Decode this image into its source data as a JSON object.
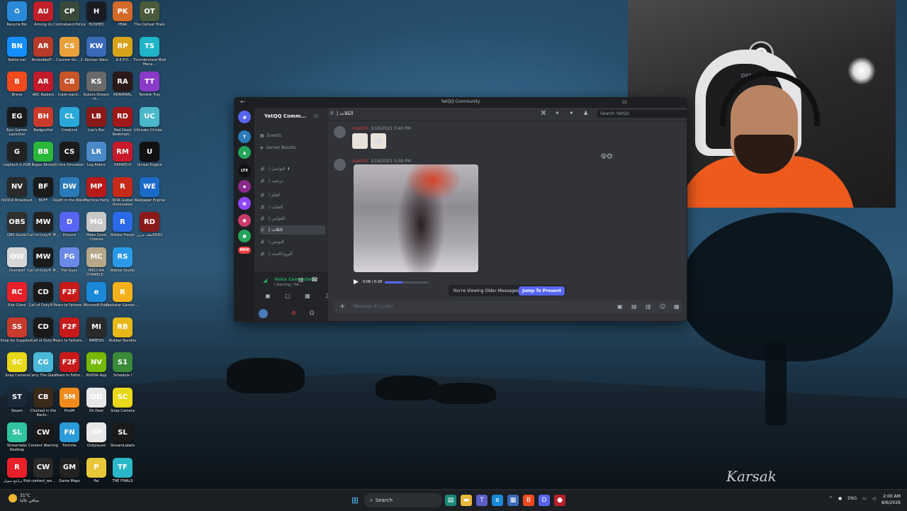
{
  "desktop": {
    "icons": [
      {
        "label": "Recycle Bin",
        "color": "#2a8ad8",
        "glyph": "♻"
      },
      {
        "label": "Among Us",
        "color": "#c0202a",
        "glyph": "AU"
      },
      {
        "label": "Contraband Police",
        "color": "#3a4a3a",
        "glyph": "CP"
      },
      {
        "label": "HUSHED",
        "color": "#1a1a22",
        "glyph": "H"
      },
      {
        "label": "PEAK",
        "color": "#d46a2a",
        "glyph": "PK"
      },
      {
        "label": "The Outlast Trials",
        "color": "#4a5a3a",
        "glyph": "OT"
      },
      {
        "label": "Battle.net",
        "color": "#148eff",
        "glyph": "BN"
      },
      {
        "label": "AnimeRedT...",
        "color": "#b83a2a",
        "glyph": "AR"
      },
      {
        "label": "Counter-Str... 2",
        "color": "#e8a13a",
        "glyph": "CS"
      },
      {
        "label": "Kitchen Wars",
        "color": "#3a6ab8",
        "glyph": "KW"
      },
      {
        "label": "R.E.P.O.",
        "color": "#d8a21a",
        "glyph": "RP"
      },
      {
        "label": "Thunderstore Mod Mana...",
        "color": "#1fb4c8",
        "glyph": "TS"
      },
      {
        "label": "Brave",
        "color": "#f04a1e",
        "glyph": "B"
      },
      {
        "label": "ARC Raiders",
        "color": "#c21a2a",
        "glyph": "AR"
      },
      {
        "label": "crash-band...",
        "color": "#c8552a",
        "glyph": "CB"
      },
      {
        "label": "Kukoro Stream ch...",
        "color": "#6a6a6a",
        "glyph": "KS"
      },
      {
        "label": "REANIMAL",
        "color": "#2a1a1a",
        "glyph": "RA"
      },
      {
        "label": "Twinkle Tray",
        "color": "#8a3ac8",
        "glyph": "TT"
      },
      {
        "label": "Epic Games Launcher",
        "color": "#1a1a1a",
        "glyph": "EG"
      },
      {
        "label": "BadgesHat",
        "color": "#c83a2a",
        "glyph": "BH"
      },
      {
        "label": "CrewLink",
        "color": "#2aa8d8",
        "glyph": "CL"
      },
      {
        "label": "Liar's Bar",
        "color": "#8a1a1a",
        "glyph": "LB"
      },
      {
        "label": "Red Dead Redempti...",
        "color": "#a01818",
        "glyph": "RD"
      },
      {
        "label": "Ultimate Chicke...",
        "color": "#4ab8c8",
        "glyph": "UC"
      },
      {
        "label": "Logitech G HUB",
        "color": "#222222",
        "glyph": "G"
      },
      {
        "label": "Bogos Binted",
        "color": "#2ab83a",
        "glyph": "BB"
      },
      {
        "label": "Crime Simulator",
        "color": "#1a1a1a",
        "glyph": "CS"
      },
      {
        "label": "Log Riders",
        "color": "#4a8ac8",
        "glyph": "LR"
      },
      {
        "label": "REMATCH",
        "color": "#c81a2a",
        "glyph": "RM"
      },
      {
        "label": "Unreal Engine",
        "color": "#111111",
        "glyph": "U"
      },
      {
        "label": "NVIDIA Broadcast",
        "color": "#2a2a2a",
        "glyph": "NV"
      },
      {
        "label": "BUFF",
        "color": "#1a1a1a",
        "glyph": "BF"
      },
      {
        "label": "Death in the Water",
        "color": "#2a7ab8",
        "glyph": "DW"
      },
      {
        "label": "Machine Party",
        "color": "#b81a1a",
        "glyph": "MP"
      },
      {
        "label": "RISK Global Domination",
        "color": "#c82a1a",
        "glyph": "R"
      },
      {
        "label": "Wallpaper Engine -...",
        "color": "#1a6ac8",
        "glyph": "WE"
      },
      {
        "label": "OBS Studio",
        "color": "#303030",
        "glyph": "OBS"
      },
      {
        "label": "Call of Duty® M...",
        "color": "#222222",
        "glyph": "MW"
      },
      {
        "label": "Discord",
        "color": "#5865f2",
        "glyph": "D"
      },
      {
        "label": "Make Good Choices",
        "color": "#c8c8c8",
        "glyph": "MG"
      },
      {
        "label": "Roblox Player",
        "color": "#2a6ae8",
        "glyph": "R"
      },
      {
        "label": "ملف عربيRDR2",
        "color": "#8a1a1a",
        "glyph": "RD"
      },
      {
        "label": "Overwolf",
        "color": "#d8d8d8",
        "glyph": "OW"
      },
      {
        "label": "Call of Duty® M...",
        "color": "#1a1a1a",
        "glyph": "MW"
      },
      {
        "label": "Fall Guys",
        "color": "#6a8ae8",
        "glyph": "FG"
      },
      {
        "label": "MECCHA CHAMELE...",
        "color": "#b8a88a",
        "glyph": "MC"
      },
      {
        "label": "Roblox Studio",
        "color": "#2a9ae8",
        "glyph": "RS"
      },
      {
        "label": "Riot Client",
        "color": "#e8202a",
        "glyph": "RC"
      },
      {
        "label": "Call of Duty® ...",
        "color": "#1a1a1a",
        "glyph": "CD"
      },
      {
        "label": "Fears to Fathom...",
        "color": "#c81a1a",
        "glyph": "F2F"
      },
      {
        "label": "Microsoft Edge",
        "color": "#1a8ad8",
        "glyph": "e"
      },
      {
        "label": "Rockstar Games ...",
        "color": "#f4b01a",
        "glyph": "R"
      },
      {
        "label": "Shop for Supplies - ...",
        "color": "#c83a2a",
        "glyph": "SS"
      },
      {
        "label": "Call of Duty®",
        "color": "#1a1a1a",
        "glyph": "CD"
      },
      {
        "label": "Fears to Fathom...",
        "color": "#c81a1a",
        "glyph": "F2F"
      },
      {
        "label": "MIMESIS",
        "color": "#2a2a2a",
        "glyph": "MI"
      },
      {
        "label": "Rubber Bandits",
        "color": "#e8b81a",
        "glyph": "RB"
      },
      {
        "label": "Snap Camera",
        "color": "#e8d81a",
        "glyph": "SC"
      },
      {
        "label": "Carry The Glass",
        "color": "#4ab8d8",
        "glyph": "CG"
      },
      {
        "label": "Fears to Fatho...",
        "color": "#c81a1a",
        "glyph": "F2F"
      },
      {
        "label": "NVIDIA App",
        "color": "#76b900",
        "glyph": "NV"
      },
      {
        "label": "Schedule I",
        "color": "#3a8a3a",
        "glyph": "S1"
      },
      {
        "label": "Steam",
        "color": "#1b2838",
        "glyph": "ST"
      },
      {
        "label": "Chained in the Backr...",
        "color": "#3a2a1a",
        "glyph": "CB"
      },
      {
        "label": "FiveM",
        "color": "#f08a1a",
        "glyph": "5M"
      },
      {
        "label": "Oh Deer",
        "color": "#e8e8e8",
        "glyph": "OD"
      },
      {
        "label": "Snap Camera",
        "color": "#e8d81a",
        "glyph": "SC"
      },
      {
        "label": "Streamlabs Desktop",
        "color": "#31c3a2",
        "glyph": "SL"
      },
      {
        "label": "Content Warning",
        "color": "#1a1a1a",
        "glyph": "CW"
      },
      {
        "label": "Fortnite",
        "color": "#2a9ad8",
        "glyph": "FN"
      },
      {
        "label": "Outplayed",
        "color": "#e8e8e8",
        "glyph": "OP"
      },
      {
        "label": "StreamLabels",
        "color": "#1a1a1a",
        "glyph": "SL"
      },
      {
        "label": "برنامج تمويل Riot",
        "color": "#e8202a",
        "glyph": "R"
      },
      {
        "label": "content_wa...",
        "color": "#2a2a2a",
        "glyph": "CW"
      },
      {
        "label": "Game Maps",
        "color": "#222222",
        "glyph": "GM"
      },
      {
        "label": "Pal",
        "color": "#e8c83a",
        "glyph": "P"
      },
      {
        "label": "THE FINALS",
        "color": "#2ab8c8",
        "glyph": "TF"
      }
    ]
  },
  "webcam": {
    "brand_text": "DXRACER"
  },
  "discord": {
    "window_title": "YatQQ Community",
    "server_name": "YatQQ Comm...",
    "menu": {
      "events": "Events",
      "server_boosts": "Server Boosts"
    },
    "channels": [
      {
        "name": "| التواصل ⬇",
        "active": false
      },
      {
        "name": "| ترحيب",
        "active": false
      },
      {
        "name": "| العام",
        "active": false
      },
      {
        "name": "| الشات",
        "active": false
      },
      {
        "name": "| القوانين",
        "active": false
      },
      {
        "name": "| الكلات",
        "active": true
      },
      {
        "name": "| البوتس",
        "active": false
      },
      {
        "name": "| البرودكاست",
        "active": false
      }
    ],
    "voice": {
      "status": "Voice Connected",
      "sub": "| Gaming / Yat..."
    },
    "chat": {
      "channel_name": "| الكلات",
      "search_placeholder": "Search YatQQ",
      "messages": [
        {
          "author": "mash3l",
          "time": "3/16/2023 3:40 PM"
        },
        {
          "author": "mash3l",
          "time": "3/16/2023 3:58 PM"
        }
      ],
      "video_time": "0:06 / 0:29",
      "video_progress_percent": 40,
      "older_notice": "You're Viewing Older Messages",
      "jump_label": "Jump To Present",
      "message_placeholder": "Message # | الكلات"
    }
  },
  "taskbar": {
    "weather_temp": "31°C",
    "weather_desc": "صافي غالبا",
    "search_label": "Search",
    "language": "ENG",
    "time": "2:00 AM",
    "date": "8/6/2026"
  },
  "signature": "Karsak"
}
